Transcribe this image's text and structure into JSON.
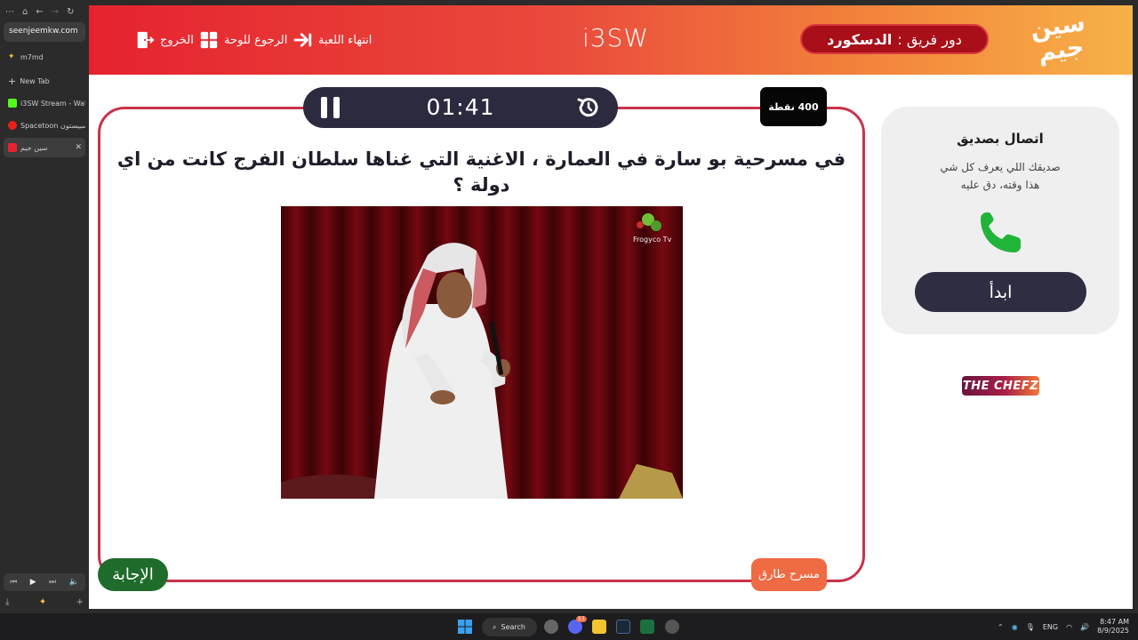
{
  "browser": {
    "address": "seenjeemkw.com",
    "tabs": [
      {
        "label": "m7md",
        "active": false
      },
      {
        "label": "New Tab",
        "active": false
      },
      {
        "label": "i3SW Stream - Wat",
        "active": false
      },
      {
        "label": "Spacetoon سبيستون",
        "active": false
      },
      {
        "label": "سين جيم",
        "active": true
      }
    ]
  },
  "header": {
    "logo_text_line1": "سين",
    "logo_text_line2": "جيم",
    "turn_label": "دور فريق :",
    "team_name": "الدسكورد",
    "brand": "i3SW",
    "end_game_label": "انتهاء اللعبة",
    "back_to_board_label": "الرجوع للوحة",
    "exit_label": "الخروج"
  },
  "question": {
    "timer": "01:41",
    "points": "400 نقطة",
    "text": "في مسرحية بو سارة في العمارة ، الاغنية التي غناها سلطان الفرج كانت من اي دولة ؟",
    "image_watermark": "Frogyco Tv",
    "answer_label": "الإجابة",
    "category": "مسرح طارق"
  },
  "help": {
    "title": "اتصال بصديق",
    "desc_line1": "صديقك اللي يعرف كل شي",
    "desc_line2": "هذا وقته، دق عليه",
    "start_label": "ابدأ"
  },
  "sponsor": "THE CHEFZ",
  "taskbar": {
    "search_label": "Search",
    "language": "ENG",
    "time": "8:47 AM",
    "date": "8/9/2025",
    "badge_count": "53"
  },
  "colors": {
    "header_start": "#e5232f",
    "header_end": "#f7b148",
    "card_border": "#c9334a",
    "timer_bg": "#2c2a3e",
    "answer_bg": "#1f6b2b",
    "category_bg": "#ee6b44",
    "phone_green": "#21b43a"
  }
}
